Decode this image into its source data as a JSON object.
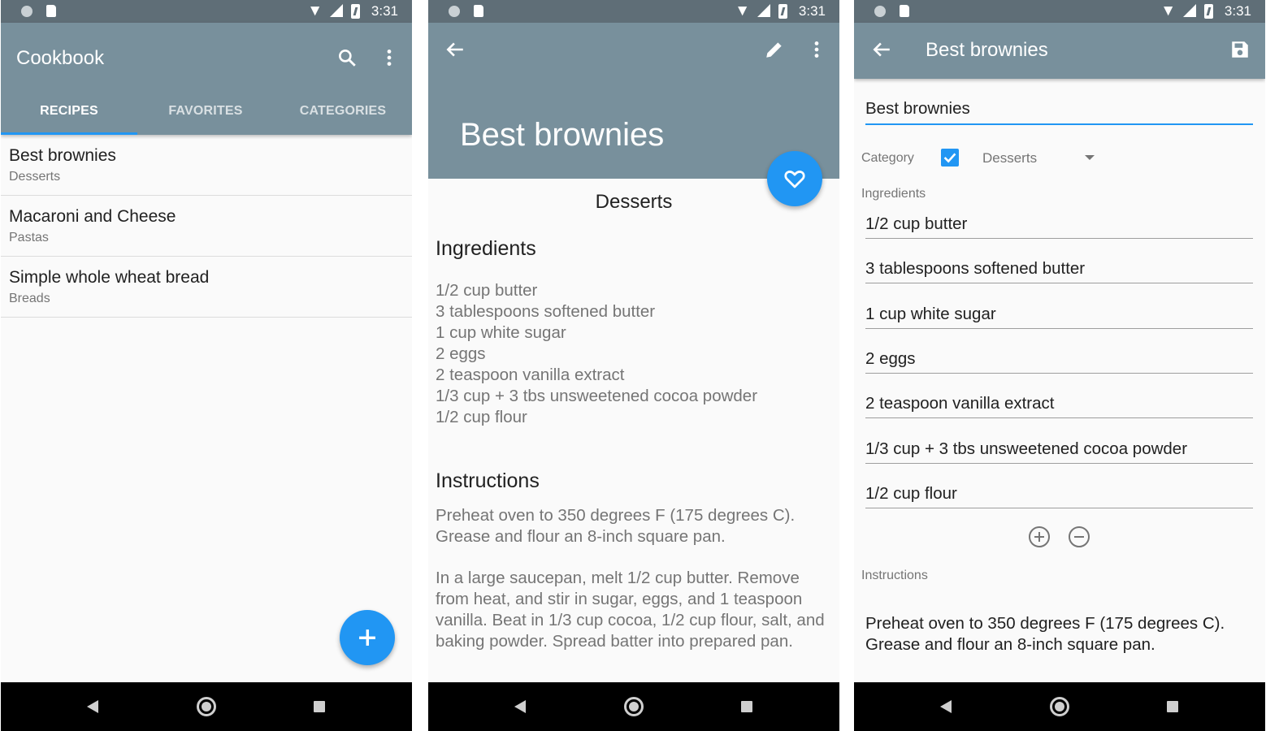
{
  "status_bar": {
    "time": "3:31"
  },
  "screen_list": {
    "app_title": "Cookbook",
    "tabs": [
      {
        "label": "RECIPES"
      },
      {
        "label": "FAVORITES"
      },
      {
        "label": "CATEGORIES"
      }
    ],
    "active_tab": "RECIPES",
    "recipes": [
      {
        "title": "Best brownies",
        "category": "Desserts"
      },
      {
        "title": "Macaroni and Cheese",
        "category": "Pastas"
      },
      {
        "title": "Simple whole wheat bread",
        "category": "Breads"
      }
    ],
    "fab_icon": "plus-icon"
  },
  "screen_detail": {
    "title": "Best brownies",
    "category": "Desserts",
    "ingredients_heading": "Ingredients",
    "ingredients": [
      "1/2 cup butter",
      "3 tablespoons softened butter",
      "1 cup white sugar",
      "2 eggs",
      "2 teaspoon vanilla extract",
      "1/3 cup + 3 tbs unsweetened cocoa powder",
      "1/2 cup flour"
    ],
    "instructions_heading": "Instructions",
    "instructions": [
      "Preheat oven to 350 degrees F (175 degrees C). Grease and flour an 8-inch square pan.",
      "In a large saucepan, melt 1/2 cup butter. Remove from heat, and stir in sugar, eggs, and 1 teaspoon vanilla. Beat in 1/3 cup cocoa, 1/2 cup flour, salt, and baking powder. Spread batter into prepared pan."
    ],
    "fab_icon": "heart-icon"
  },
  "screen_edit": {
    "title": "Best brownies",
    "name_value": "Best brownies",
    "category_label": "Category",
    "category_checked": true,
    "category_value": "Desserts",
    "ingredients_label": "Ingredients",
    "ingredients": [
      "1/2 cup butter",
      "3 tablespoons softened butter",
      "1 cup white sugar",
      "2 eggs",
      "2 teaspoon vanilla extract",
      "1/3 cup + 3 tbs unsweetened cocoa powder",
      "1/2 cup flour"
    ],
    "instructions_label": "Instructions",
    "instructions_value": "Preheat oven to 350 degrees F (175 degrees C). Grease and flour an 8-inch square pan."
  },
  "colors": {
    "primary": "#78909c",
    "status_bar": "#5f6e77",
    "accent": "#2196f3"
  }
}
